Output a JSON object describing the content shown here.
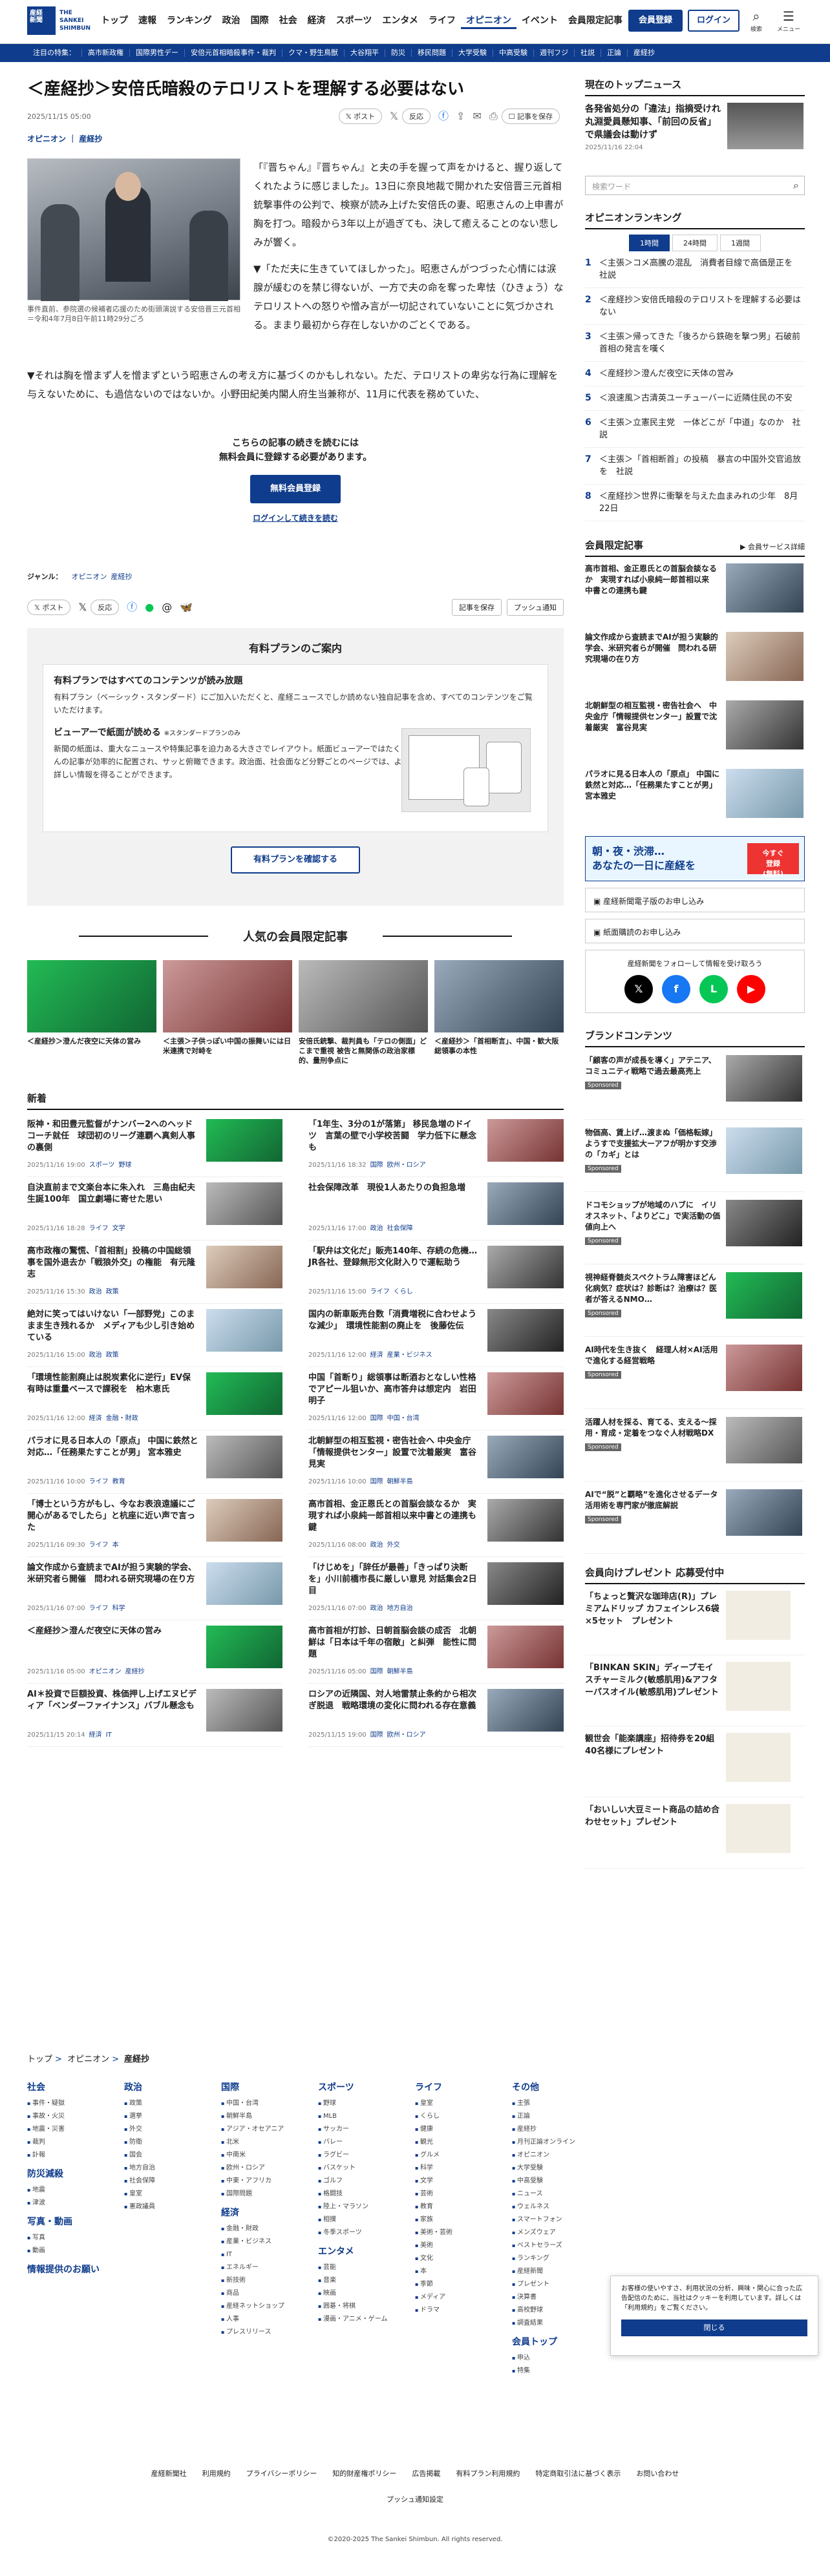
{
  "header": {
    "logo": "産経\n新聞",
    "logo_en": "THE\nSANKEI\nSHIMBUN",
    "nav": [
      "トップ",
      "速報",
      "ランキング",
      "政治",
      "国際",
      "社会",
      "経済",
      "スポーツ",
      "エンタメ",
      "ライフ",
      "オピニオン",
      "イベント",
      "会員限定記事"
    ],
    "member_btn": "会員登録",
    "login_btn": "ログイン",
    "search_label": "検索",
    "menu_label": "メニュー"
  },
  "subnav": [
    "注目の特集：",
    "高市新政権",
    "国際男性デー",
    "安倍元首相暗殺事件・裁判",
    "クマ・野生鳥獣",
    "大谷翔平",
    "防災",
    "移民問題",
    "大学受験",
    "中高受験",
    "週刊フジ",
    "社説",
    "正論",
    "産経抄"
  ],
  "article": {
    "title": "＜産経抄＞安倍氏暗殺のテロリストを理解する必要はない",
    "date": "2025/11/15 05:00",
    "share_post": "ポスト",
    "share_react": "反応",
    "save": "記事を保存",
    "category_1": "オピニオン",
    "category_2": "産経抄",
    "caption": "事件直前、参院選の候補者応援のため街頭演説する安倍晋三元首相＝令和4年7月8日午前11時29分ごろ",
    "p1": "「『晋ちゃん』『晋ちゃん』と夫の手を握って声をかけると、握り返してくれたように感じました」。13日に奈良地裁で開かれた安倍晋三元首相銃撃事件の公判で、検察が読み上げた安倍氏の妻、昭恵さんの上申書が胸を打つ。暗殺から3年以上が過ぎても、決して癒えることのない悲しみが響く。",
    "p2": "▼「ただ夫に生きていてほしかった」。昭恵さんがつづった心情には涙腺が緩むのを禁じ得ないが、一方で夫の命を奪った卑怯（ひきょう）なテロリストへの怒りや憎み言が一切記されていないことに気づかされる。ままり最初から存在しないかのごとくである。",
    "p3": "▼それは胸を憎まず人を憎まずという昭恵さんの考え方に基づくのかもしれない。ただ、テロリストの卑劣な行為に理解を与えないために、も過信ないのではないか。小野田紀美内閣人府生当兼称が、11月に代表を務めていた、",
    "pw1": "こちらの記事の続きを読むには",
    "pw2": "無料会員に登録する必要があります。",
    "pw_btn": "無料会員登録",
    "pw_link": "ログインして続きを読む",
    "genre_label": "ジャンル：",
    "genre_1": "オピニオン",
    "genre_2": "産経抄",
    "push": "プッシュ通知"
  },
  "plan": {
    "title": "有料プランのご案内",
    "h1": "有料プランではすべてのコンテンツが読み放題",
    "p1": "有料プラン（ベーシック・スタンダード）にご加入いただくと、産経ニュースでしか読めない独自記事を含め、すべてのコンテンツをご覧いただけます。",
    "h2": "ビューアーで紙面が読める",
    "h2s": "※スタンダードプランのみ",
    "p2": "新聞の紙面は、重大なニュースや特集記事を迫力ある大きさでレイアウト。紙面ビューアーではたくさんの記事が効率的に配置され、サッと俯瞰できます。政治面、社会面など分野ごとのページでは、より詳しい情報を得ることができます。",
    "btn": "有料プランを確認する"
  },
  "popular": {
    "title": "人気の会員限定記事",
    "items": [
      "＜産経抄＞澄んだ夜空に天体の営み",
      "＜主張＞子供っぽい中国の振舞いには日米連携で対峙を",
      "安倍氏銃撃、裁判員も「テロの側面」どこまで重視 被告と無関係の政治家標的、量刑争点に",
      "＜産経抄＞「首相断言」、中国・歓大阪総領事の本性"
    ]
  },
  "news": {
    "title": "新着",
    "items": [
      {
        "t": "阪神・和田豊元監督がナンバー2へのヘッドコーチ就任　球団初のリーグ連覇へ真剣人事の裏側",
        "d": "2025/11/16 19:00",
        "c": "スポーツ",
        "s": "野球"
      },
      {
        "t": "「1年生、3分の1が落第」 移民急増のドイツ　言葉の壁で小学校苦闘　学力低下に懸念も",
        "d": "2025/11/16 18:32",
        "c": "国際",
        "s": "欧州・ロシア"
      },
      {
        "t": "自決直前まで文楽台本に朱入れ　三島由紀夫生誕100年　国立劇場に寄せた思い",
        "d": "2025/11/16 18:28",
        "c": "ライフ",
        "s": "文学"
      },
      {
        "t": "社会保障改革　現役1人あたりの負担急増",
        "d": "2025/11/16 17:00",
        "c": "政治",
        "s": "社会保障"
      },
      {
        "t": "高市政権の驚慌、「首相割」投稿の中国総領事を国外退去か「戦狼外交」の権能　有元隆志",
        "d": "2025/11/16 15:30",
        "c": "政治",
        "s": "政策"
      },
      {
        "t": "「駅弁は文化だ」販売140年、存続の危機…JR各社、登録無形文化財入りで運転助う",
        "d": "2025/11/16 15:00",
        "c": "ライフ",
        "s": "くらし"
      },
      {
        "t": "絶対に笑ってはいけない「一部野党」このままま生き残れるか　メディアも少し引き始めている",
        "d": "2025/11/16 15:00",
        "c": "政治",
        "s": "政策"
      },
      {
        "t": "国内の新車販売台数「消費増税に合わせような減少」　環境性能割の廃止を　後藤佐伝",
        "d": "2025/11/16 12:00",
        "c": "経済",
        "s": "産業・ビジネス"
      },
      {
        "t": "「環境性能割廃止は脱炭素化に逆行」EV保有時は重量ベースで課税を　柏木恵氏",
        "d": "2025/11/16 12:00",
        "c": "経済",
        "s": "金融・財政"
      },
      {
        "t": "中国「首断り」総領事は断酒おとなしい性格でアピール狙いか、高市答弁は想定内　岩田明子",
        "d": "2025/11/16 12:00",
        "c": "国際",
        "s": "中国・台湾"
      },
      {
        "t": "パラオに見る日本人の「原点」 中国に鉄然と対応…「任務果たすことが男」 宮本雅史",
        "d": "2025/11/16 10:00",
        "c": "ライフ",
        "s": "教育"
      },
      {
        "t": "北朝鮮型の相互監視・密告社会へ 中央金庁「情報提供センター」設置で沈着厳実　富谷見実",
        "d": "2025/11/16 10:00",
        "c": "国際",
        "s": "朝鮮半島"
      },
      {
        "t": "「博士という方がもし、今なお表浪遠議にご開心があるでしたら」と杭座に近い声で言った",
        "d": "2025/11/16 09:30",
        "c": "ライフ",
        "s": "本"
      },
      {
        "t": "高市首相、金正恩氏との首脳会談なるか　実現すれば小泉純一郎首相以来中書との連携も鍵",
        "d": "2025/11/16 08:00",
        "c": "政治",
        "s": "外交"
      },
      {
        "t": "論文作成から査読までAIが担う実験的学会、米研究者ら開催　問われる研究現場の在り方",
        "d": "2025/11/16 07:00",
        "c": "ライフ",
        "s": "科学"
      },
      {
        "t": "「けじめを」「辞任が最善」「きっぱり決断を」小川前橋市長に厳しい意見 対話集会2日目",
        "d": "2025/11/16 07:00",
        "c": "政治",
        "s": "地方自治"
      },
      {
        "t": "＜産経抄＞澄んだ夜空に天体の営み",
        "d": "2025/11/16 05:00",
        "c": "オピニオン",
        "s": "産経抄"
      },
      {
        "t": "高市首相が打診、日朝首脳会談の成否　北朝鮮は「日本は千年の宿敵」と糾弾　能性に問題",
        "d": "2025/11/16 05:00",
        "c": "国際",
        "s": "朝鮮半島"
      },
      {
        "t": "AI＊投資で巨額投資、株価押し上げエヌビディア「ベンダーファイナンス」バブル懸念も",
        "d": "2025/11/15 20:14",
        "c": "経済",
        "s": "IT"
      },
      {
        "t": "ロシアの近隣国、対人地雷禁止条約から相次ぎ脱退　戦略環境の変化に問われる存在意義",
        "d": "2025/11/15 19:00",
        "c": "国際",
        "s": "欧州・ロシア"
      }
    ]
  },
  "side": {
    "top_title": "現在のトップニュース",
    "top_t": "各発省処分の「違法」指摘受けれ丸淵愛員懸知事、「前回の反省」で県議会は動けず",
    "top_d": "2025/11/16 22:04",
    "search_ph": "検索ワード",
    "rank_title": "オピニオンランキング",
    "tabs": [
      "1時間",
      "24時間",
      "1週間"
    ],
    "rank": [
      "＜主張＞コメ高騰の混乱　消費者目線で高価是正を　社説",
      "＜産経抄＞安倍氏暗殺のテロリストを理解する必要はない",
      "＜主張＞帰ってきた「後ろから鉄砲を撃つ男」石破前首相の発言を嘆く",
      "＜産経抄＞澄んだ夜空に天体の営み",
      "＜浪速風＞古清英ユーチューバーに近隣住民の不安",
      "＜主張＞立憲民主党　一体どこが「中道」なのか　社説",
      "＜主張＞「首相断首」の投稿　暴言の中国外交官追放を　社説",
      "＜産経抄＞世界に衝撃を与えた血まみれの少年　8月22日"
    ],
    "mem_title": "会員限定記事",
    "mem_link": "▶ 会員サービス詳細",
    "mem": [
      "高市首相、金正恩氏との首脳会談なるか　実現すれば小泉純一郎首相以来　中書との連携も鍵",
      "論文作成から査読までAIが担う実験的学会、米研究者らが開催　問われる研究現場の在り方",
      "北朝鮮型の相互監視・密告社会へ　中央金庁「情報提供センター」設置で沈着厳実　富谷見実",
      "パラオに見る日本人の「原点」 中国に鉄然と対応…「任務果たすことが男」 宮本雅史"
    ],
    "ad1": "朝・夜・渋滞…\nあなたの一日に産経を",
    "ad2": "今すぐ\n登録\n(無料)",
    "btn1": "産経新聞電子版のお申し込み",
    "btn2": "紙面購読のお申し込み",
    "sns_note": "産経新聞をフォローして情報を受け取ろう",
    "brand_title": "ブランドコンテンツ",
    "brand": [
      "「顧客の声が成長を導く」アテニア、コミュニティ戦略で過去最高売上",
      "物価高、賃上げ…渡まぬ「価格転嫁」ようすで支援拡大ーアフが明かす交渉の「カギ」とは",
      "ドコモショップが地域のハブに　イリオスネット、「よりどこ」で実活動の価値向上へ",
      "視神経脊髄炎スペクトラム障害ほどん化病気？症状は？診断は？治療は？医者が答えるNMO…",
      "AI時代を生き抜く　経理人材×AI活用で進化する経営戦略",
      "活躍人材を採る、育てる、支える〜採用・育成・定着をつなぐ人材戦略DX",
      "AIで“脱”と覇略”を進化させるデータ活用術を専門家が徹底解説"
    ],
    "sponsored": "Sponsored",
    "present_title": "会員向けプレゼント 応募受付中",
    "present": [
      "「ちょっと贅沢な珈琲店(R)」プレミアムドリップ カフェインレス6袋×5セット　プレゼント",
      "「BINKAN SKIN」ディープモイスチャーミルク(敏感肌用)&アフターパスオイル(敏感肌用)プレゼント",
      "観世会「能楽講座」招待券を20組40名様にプレゼント",
      "「おいしい大豆ミート商品の詰め合わせセット」プレゼント"
    ]
  },
  "crumb": [
    "トップ",
    "オピニオン",
    "産経抄"
  ],
  "footer": {
    "cols": [
      {
        "h": "社会",
        "items": [
          "事件・疑獄",
          "事故・火災",
          "地震・災害",
          "裁判",
          "訃報"
        ]
      },
      {
        "h": "防災減殺",
        "items": [
          "地震",
          "津波"
        ]
      },
      {
        "h": "写真・動画",
        "items": [
          "写真",
          "動画"
        ]
      },
      {
        "h": "情報提供のお願い",
        "items": []
      },
      {
        "h": "政治",
        "items": [
          "政策",
          "選挙",
          "外交",
          "防衛",
          "国会",
          "地方自治",
          "社会保障",
          "皇室",
          "憲政議員"
        ]
      },
      {
        "h": "国際",
        "items": [
          "中国・台湾",
          "朝鮮半島",
          "アジア・オセアニア",
          "北米",
          "中南米",
          "欧州・ロシア",
          "中東・アフリカ",
          "国際問題"
        ]
      },
      {
        "h": "経済",
        "items": [
          "金融・財政",
          "産業・ビジネス",
          "IT",
          "エネルギー",
          "新技術",
          "商品",
          "産経ネットショップ",
          "人事",
          "プレスリリース"
        ]
      },
      {
        "h": "スポーツ",
        "items": [
          "野球",
          "MLB",
          "サッカー",
          "バレー",
          "ラグビー",
          "バスケット",
          "ゴルフ",
          "格闘技",
          "陸上・マラソン",
          "相撲",
          "冬季スポーツ"
        ]
      },
      {
        "h": "エンタメ",
        "items": [
          "芸能",
          "音楽",
          "映画",
          "囲碁・将棋",
          "漫画・アニメ・ゲーム"
        ]
      },
      {
        "h": "ライフ",
        "items": [
          "皇室",
          "くらし",
          "健康",
          "観光",
          "グルメ",
          "科学",
          "文学",
          "芸術",
          "教育",
          "家族",
          "美術・芸術",
          "美術",
          "文化",
          "本",
          "季節",
          "メディア",
          "ドラマ"
        ]
      },
      {
        "h": "その他",
        "items": [
          "主張",
          "正論",
          "産経抄",
          "月刊正論オンライン",
          "オピニオン",
          "大学受験",
          "中高受験",
          "ニュース",
          "ウェルネス",
          "スマートフォン",
          "メンズウェア",
          "ベストセラーズ",
          "ランキング",
          "産経新聞",
          "プレゼント",
          "決算書",
          "高校野球",
          "調査結果"
        ]
      },
      {
        "h": "会員トップ",
        "items": [
          "申込",
          "特集"
        ]
      }
    ]
  },
  "cookie": {
    "text": "お客様の使いやすさ、利用状況の分析、興味・関心に合った広告配信のために、当社はクッキーを利用しています。詳しくは「利用規約」をご覧ください。",
    "btn": "閉じる"
  },
  "footer_links": [
    "産経新聞社",
    "利用規約",
    "プライバシーポリシー",
    "知的財産権ポリシー",
    "広告掲載",
    "有料プラン利用規約",
    "特定商取引法に基づく表示",
    "お問い合わせ"
  ],
  "push_notice": "プッシュ通知設定",
  "copyright": "©2020-2025 The Sankei Shimbun. All rights reserved.",
  "colors": {
    "brand": "#0f3c8c"
  }
}
